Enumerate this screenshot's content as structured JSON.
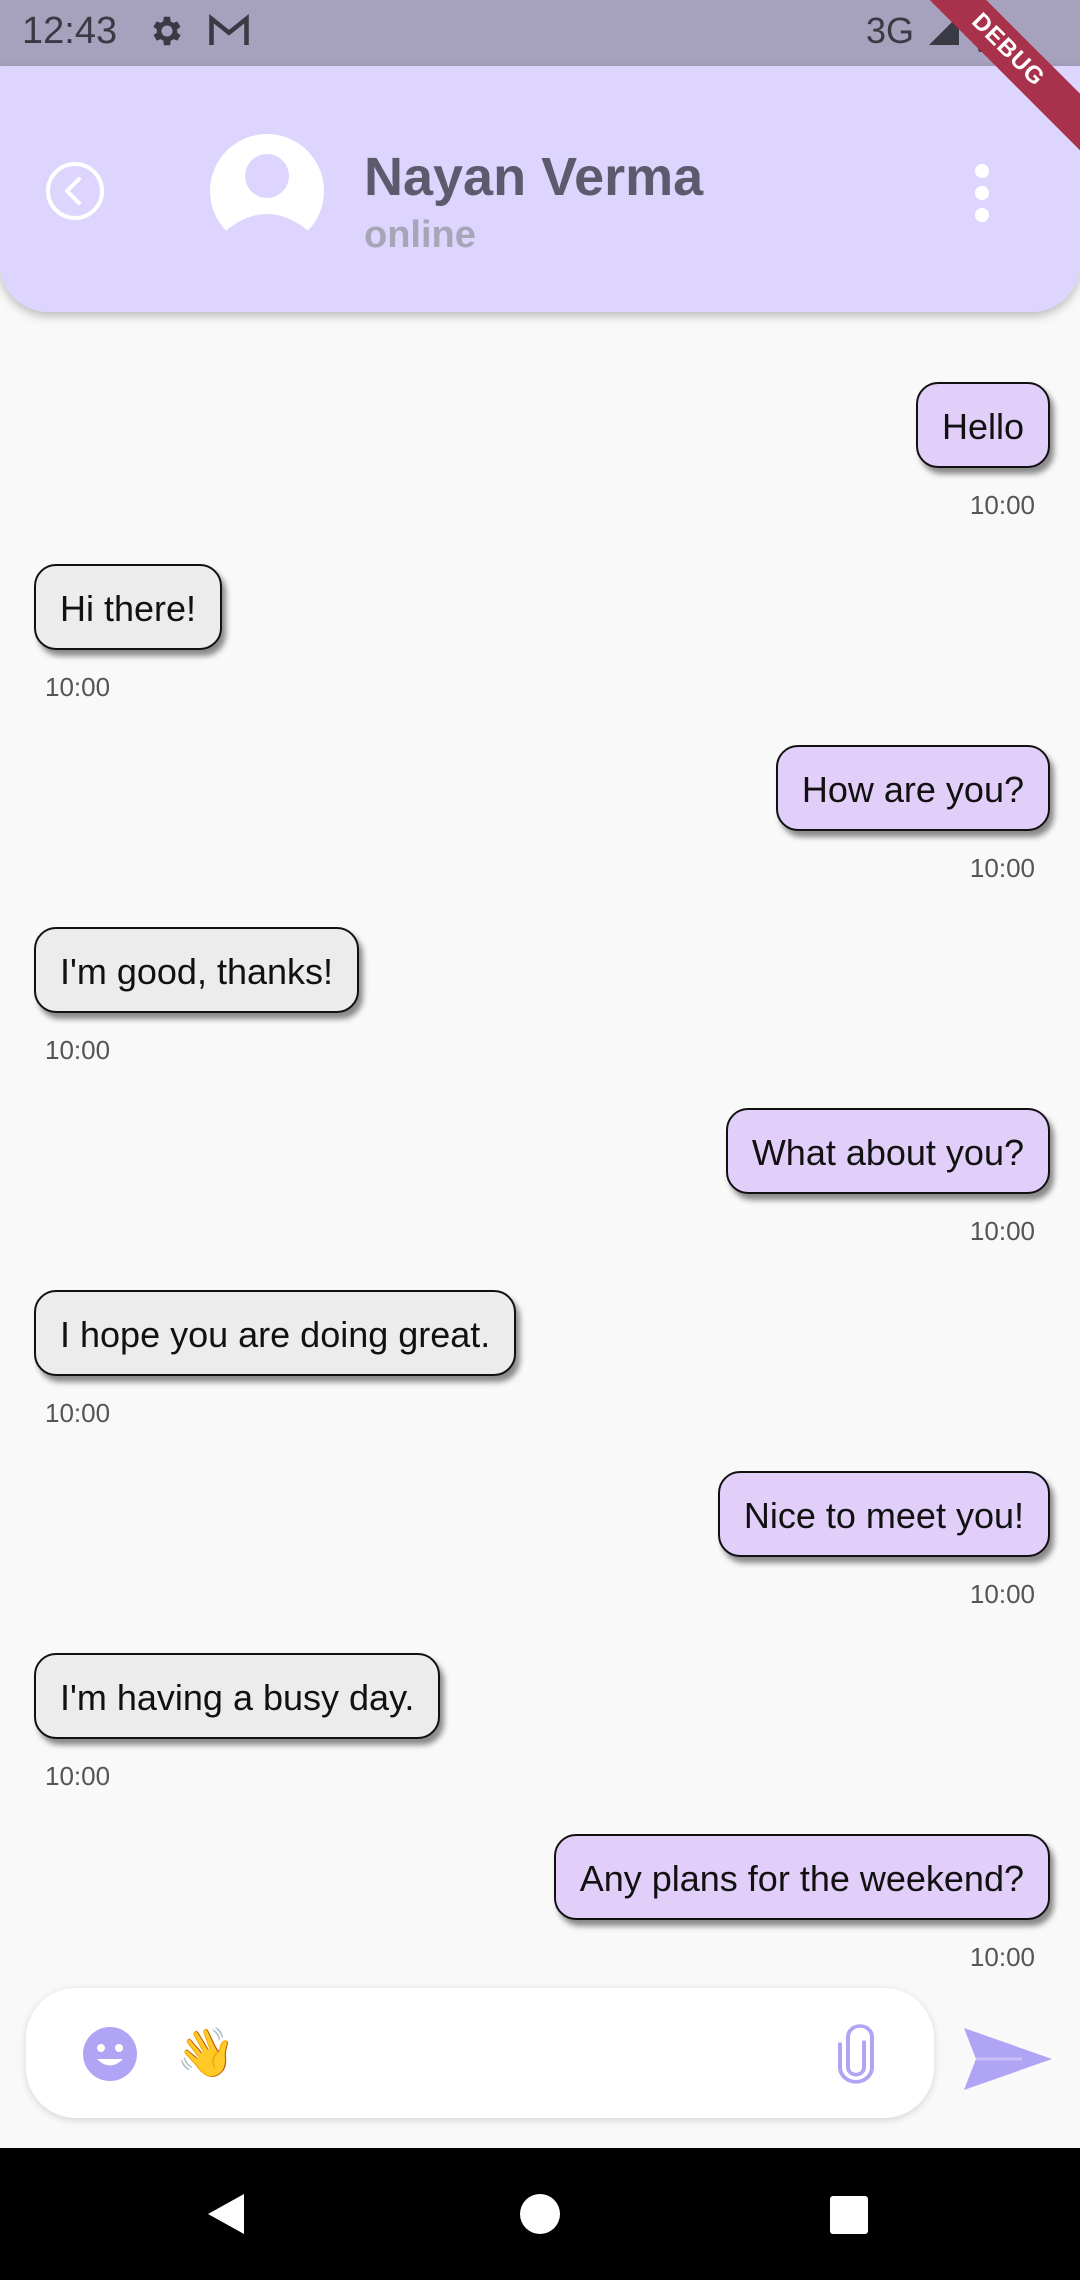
{
  "status_bar": {
    "time": "12:43",
    "network": "3G",
    "debug_label": "DEBUG",
    "icons": [
      "settings-icon",
      "gmail-icon",
      "signal-icon",
      "battery-icon"
    ]
  },
  "header": {
    "contact_name": "Nayan Verma",
    "contact_status": "online",
    "background_color": "#ddd5fd"
  },
  "messages": [
    {
      "text": "Hello",
      "time": "10:00",
      "direction": "out"
    },
    {
      "text": "Hi there!",
      "time": "10:00",
      "direction": "in"
    },
    {
      "text": "How are you?",
      "time": "10:00",
      "direction": "out"
    },
    {
      "text": "I'm good, thanks!",
      "time": "10:00",
      "direction": "in"
    },
    {
      "text": "What about you?",
      "time": "10:00",
      "direction": "out"
    },
    {
      "text": "I hope you are doing great.",
      "time": "10:00",
      "direction": "in"
    },
    {
      "text": "Nice to meet you!",
      "time": "10:00",
      "direction": "out"
    },
    {
      "text": "I'm having a busy day.",
      "time": "10:00",
      "direction": "in"
    },
    {
      "text": "Any plans for the weekend?",
      "time": "10:00",
      "direction": "out"
    }
  ],
  "composer": {
    "input_value": "👋",
    "accent_color": "#b0a4f5"
  },
  "colors": {
    "outgoing_bubble": "#e1cffa",
    "incoming_bubble": "#ececec"
  }
}
